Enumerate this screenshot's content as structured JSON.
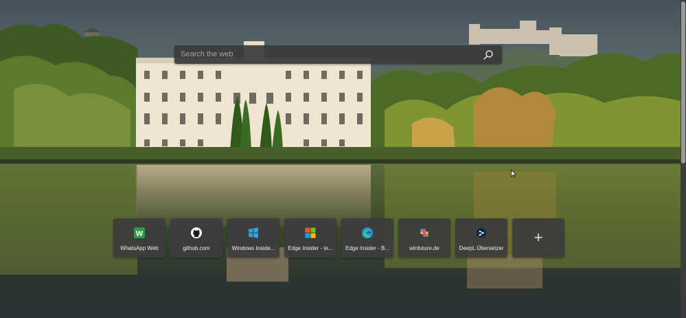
{
  "search": {
    "placeholder": "Search the web",
    "icon": "search-icon"
  },
  "quick_links": [
    {
      "label": "WhatsApp Web",
      "icon": "whatsapp-w-icon",
      "color": "#2e9a48"
    },
    {
      "label": "github.com",
      "icon": "github-icon",
      "color": "#ffffff"
    },
    {
      "label": "Windows Inside...",
      "icon": "windows-icon",
      "color": "#2aa3e6"
    },
    {
      "label": "Edge Insider - te...",
      "icon": "microsoft-icon",
      "color": "#f35325"
    },
    {
      "label": "Edge Insider - B...",
      "icon": "edge-icon",
      "color": "#2d8ee0"
    },
    {
      "label": "winfuture.de",
      "icon": "winfuture-icon",
      "color": "#d94f8a"
    },
    {
      "label": "DeepL Übersetzer",
      "icon": "deepl-icon",
      "color": "#0f2b46"
    }
  ],
  "add_tile": {
    "label": "+",
    "icon": "plus-icon"
  },
  "colors": {
    "tile_bg": "#3c3c3c",
    "search_bg": "#3a3a3a"
  }
}
